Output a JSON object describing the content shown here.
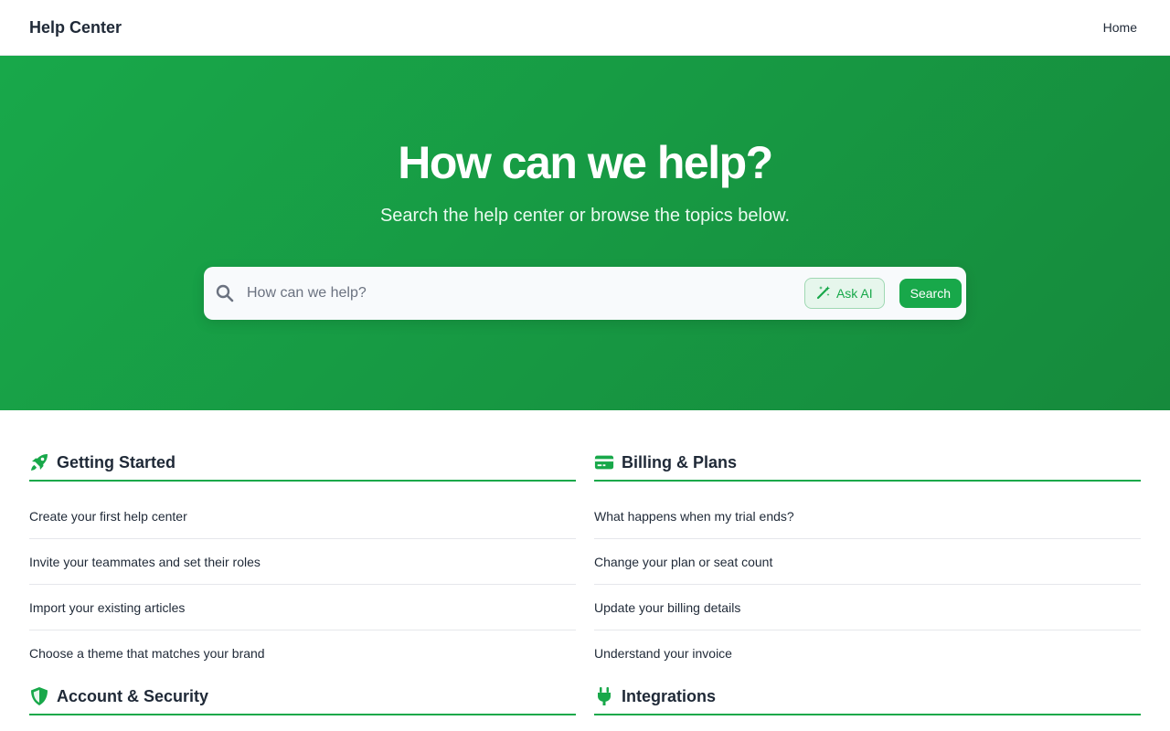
{
  "header": {
    "brand": "Help Center",
    "nav_home": "Home"
  },
  "hero": {
    "title": "How can we help?",
    "subtitle": "Search the help center or browse the topics below.",
    "search_placeholder": "How can we help?",
    "ask_ai_label": "Ask AI",
    "search_label": "Search"
  },
  "topics": [
    {
      "icon": "rocket-icon",
      "title": "Getting Started",
      "articles": [
        "Create your first help center",
        "Invite your teammates and set their roles",
        "Import your existing articles",
        "Choose a theme that matches your brand"
      ]
    },
    {
      "icon": "credit-card-icon",
      "title": "Billing & Plans",
      "articles": [
        "What happens when my trial ends?",
        "Change your plan or seat count",
        "Update your billing details",
        "Understand your invoice"
      ]
    },
    {
      "icon": "shield-icon",
      "title": "Account & Security",
      "articles": []
    },
    {
      "icon": "plug-icon",
      "title": "Integrations",
      "articles": []
    }
  ],
  "colors": {
    "accent": "#18a84a",
    "accent_dark": "#168a3c",
    "text": "#1f2937",
    "divider": "#e5e7eb"
  }
}
